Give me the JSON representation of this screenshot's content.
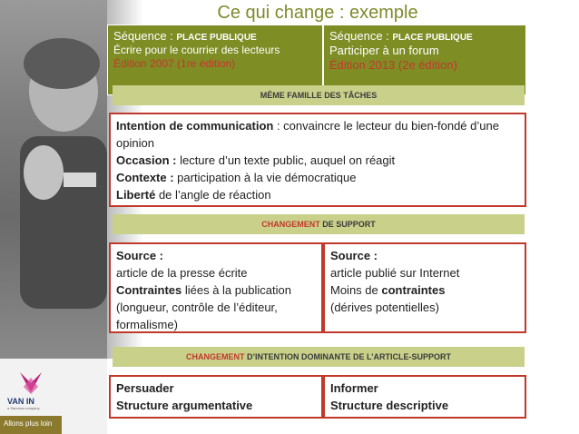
{
  "title": "Ce qui change : exemple",
  "sequences": {
    "left": {
      "prefix": "Séquence : ",
      "name": "Place publique",
      "subtitle": "Écrire pour le courrier des lecteurs",
      "edition": "Édition 2007 (1re édition)"
    },
    "right": {
      "prefix": "Séquence : ",
      "name": "Place publique",
      "subtitle": "Participer à un forum",
      "edition": "Édition 2013 (2e édition)"
    }
  },
  "bands": {
    "meme_famille": "Même famille des tâches",
    "changement_support_red": "Changement",
    "changement_support_rest": " de support",
    "changement_intention_red": "Changement",
    "changement_intention_rest": " d’Intention dominante de l’article-support"
  },
  "task_box": {
    "line1_bold": "Intention de communication",
    "line1_rest": " : convaincre le lecteur du bien-fondé d’une opinion",
    "line2_bold": "Occasion :",
    "line2_rest": " lecture d’un texte public, auquel on réagit",
    "line3_bold": "Contexte :",
    "line3_rest": " participation à la vie démocratique",
    "line4_bold": "Liberté",
    "line4_rest": " de l’angle de réaction"
  },
  "source_left": {
    "label": "Source :",
    "line1": "article de la  presse écrite",
    "line2_bold": "Contraintes",
    "line2_rest": " liées à la publication",
    "line3": "(longueur, contrôle de l’éditeur, formalisme)"
  },
  "source_right": {
    "label": "Source :",
    "line1": "article publié sur Internet",
    "line2_pre": "Moins de ",
    "line2_bold": "contraintes",
    "line3": "(dérives potentielles)"
  },
  "intent_left": {
    "line1": "Persuader",
    "line2": "Structure argumentative"
  },
  "intent_right": {
    "line1": "Informer",
    "line2": "Structure descriptive"
  },
  "logo": {
    "name": "VAN IN",
    "sub": "a Sanoma company",
    "tagline": "Allons plus loin"
  },
  "colors": {
    "olive": "#7f8d25",
    "band": "#c8d08a",
    "red": "#c0392b"
  }
}
